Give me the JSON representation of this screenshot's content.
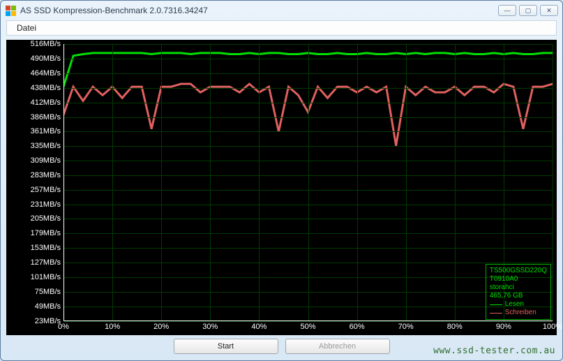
{
  "window": {
    "title": "AS SSD Kompression-Benchmark 2.0.7316.34247"
  },
  "menubar": {
    "file": "Datei"
  },
  "buttons": {
    "start": "Start",
    "abort": "Abbrechen"
  },
  "legend": {
    "device": "TS500GSSD220Q",
    "firmware": "T0910A0",
    "driver": "storahci",
    "capacity": "465,76 GB",
    "read_label": "Lesen",
    "write_label": "Schreiben"
  },
  "watermark": "www.ssd-tester.com.au",
  "chart_data": {
    "type": "line",
    "xlabel": "",
    "ylabel": "",
    "y_ticks": [
      23,
      49,
      75,
      101,
      127,
      153,
      179,
      205,
      231,
      257,
      283,
      309,
      335,
      361,
      386,
      412,
      438,
      464,
      490,
      516
    ],
    "y_tick_suffix": "MB/s",
    "x_ticks": [
      0,
      10,
      20,
      30,
      40,
      50,
      60,
      70,
      80,
      90,
      100
    ],
    "x_tick_suffix": "%",
    "ylim": [
      23,
      516
    ],
    "xlim": [
      0,
      100
    ],
    "series": [
      {
        "name": "Lesen",
        "color": "#00e000",
        "x": [
          0,
          2,
          4,
          6,
          8,
          10,
          12,
          14,
          16,
          18,
          20,
          22,
          24,
          26,
          28,
          30,
          32,
          34,
          36,
          38,
          40,
          42,
          44,
          46,
          48,
          50,
          52,
          54,
          56,
          58,
          60,
          62,
          64,
          66,
          68,
          70,
          72,
          74,
          76,
          78,
          80,
          82,
          84,
          86,
          88,
          90,
          92,
          94,
          96,
          98,
          100
        ],
        "y": [
          440,
          495,
          498,
          500,
          500,
          500,
          500,
          500,
          500,
          498,
          500,
          500,
          500,
          498,
          500,
          500,
          500,
          498,
          498,
          500,
          498,
          500,
          500,
          498,
          498,
          500,
          498,
          498,
          500,
          498,
          498,
          500,
          498,
          498,
          500,
          498,
          500,
          498,
          500,
          500,
          498,
          500,
          498,
          498,
          500,
          498,
          500,
          498,
          498,
          500,
          500
        ]
      },
      {
        "name": "Schreiben",
        "color": "#e06060",
        "x": [
          0,
          2,
          4,
          6,
          8,
          10,
          12,
          14,
          16,
          18,
          20,
          22,
          24,
          26,
          28,
          30,
          32,
          34,
          36,
          38,
          40,
          42,
          44,
          46,
          48,
          50,
          52,
          54,
          56,
          58,
          60,
          62,
          64,
          66,
          68,
          70,
          72,
          74,
          76,
          78,
          80,
          82,
          84,
          86,
          88,
          90,
          92,
          94,
          96,
          98,
          100
        ],
        "y": [
          390,
          440,
          415,
          440,
          425,
          440,
          420,
          440,
          440,
          365,
          440,
          440,
          445,
          445,
          430,
          440,
          440,
          440,
          430,
          445,
          430,
          440,
          360,
          440,
          425,
          395,
          440,
          420,
          440,
          440,
          430,
          440,
          430,
          440,
          335,
          440,
          425,
          440,
          430,
          430,
          440,
          425,
          440,
          440,
          430,
          445,
          440,
          365,
          440,
          440,
          445
        ]
      }
    ]
  }
}
